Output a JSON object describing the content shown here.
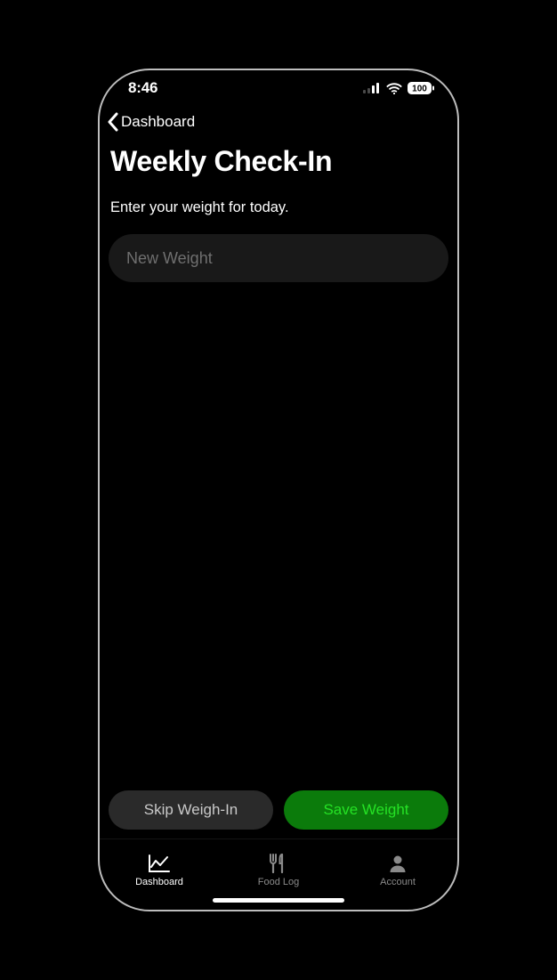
{
  "status": {
    "time": "8:46",
    "battery": "100"
  },
  "nav": {
    "back_label": "Dashboard"
  },
  "page": {
    "title": "Weekly Check-In",
    "subtitle": "Enter your weight for today."
  },
  "input": {
    "value": "",
    "placeholder": "New Weight"
  },
  "buttons": {
    "skip_label": "Skip Weigh-In",
    "save_label": "Save Weight"
  },
  "tabs": {
    "dashboard": "Dashboard",
    "foodlog": "Food Log",
    "account": "Account"
  }
}
